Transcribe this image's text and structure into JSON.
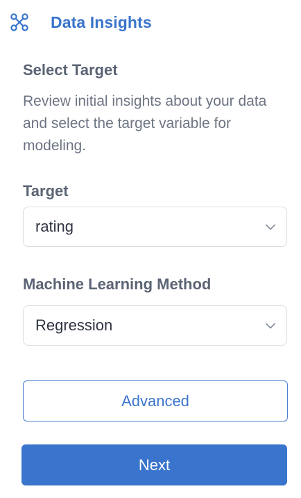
{
  "header": {
    "title": "Data Insights",
    "icon": "workflow-nodes-icon",
    "accent_color": "#3a74cc"
  },
  "section": {
    "title": "Select Target",
    "description": "Review initial insights about your data and select the target variable for modeling."
  },
  "fields": {
    "target": {
      "label": "Target",
      "value": "rating"
    },
    "method": {
      "label": "Machine Learning Method",
      "value": "Regression"
    }
  },
  "buttons": {
    "advanced_label": "Advanced",
    "next_label": "Next"
  }
}
